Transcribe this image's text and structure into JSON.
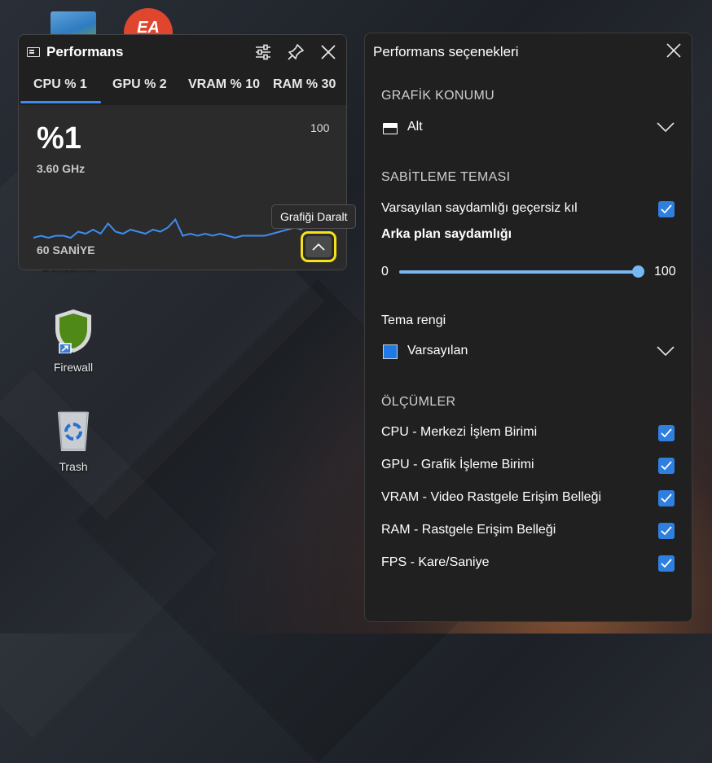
{
  "desktop": {
    "icons": [
      {
        "label": "Denetimler"
      },
      {
        "label": "Firewall"
      },
      {
        "label": "Trash"
      }
    ]
  },
  "performance_widget": {
    "title": "Performans",
    "tabs": [
      {
        "label": "CPU % 1",
        "selected": true
      },
      {
        "label": "GPU % 2",
        "selected": false
      },
      {
        "label": "VRAM % 10",
        "selected": false
      },
      {
        "label": "RAM % 30",
        "selected": false
      }
    ],
    "value": "%1",
    "max": "100",
    "frequency": "3.60 GHz",
    "time_window": "60 SANİYE",
    "tooltip": "Grafiği Daralt",
    "graph_series": [
      2,
      3,
      2,
      3,
      3,
      2,
      5,
      4,
      6,
      4,
      9,
      5,
      4,
      6,
      5,
      4,
      6,
      5,
      7,
      11,
      3,
      4,
      3,
      4,
      3,
      4,
      3,
      2,
      3,
      3,
      3,
      3,
      4,
      5,
      6,
      7,
      6
    ],
    "accent_color": "#3f8cf0",
    "highlight_color": "#f5e21a"
  },
  "options_panel": {
    "title": "Performans seçenekleri",
    "graph_position": {
      "heading": "GRAFİK KONUMU",
      "value": "Alt"
    },
    "pin_theme": {
      "heading": "SABİTLEME TEMASI",
      "override_transparency": {
        "label": "Varsayılan saydamlığı geçersiz kıl",
        "checked": true
      },
      "background_transparency": {
        "label": "Arka plan saydamlığı",
        "min": "0",
        "max": "100",
        "value": 100
      }
    },
    "theme_color": {
      "heading": "Tema rengi",
      "value": "Varsayılan",
      "swatch": "#1f7ae8"
    },
    "metrics": {
      "heading": "ÖLÇÜMLER",
      "items": [
        {
          "label": "CPU - Merkezi İşlem Birimi",
          "checked": true
        },
        {
          "label": "GPU - Grafik İşleme Birimi",
          "checked": true
        },
        {
          "label": "VRAM - Video Rastgele Erişim Belleği",
          "checked": true
        },
        {
          "label": "RAM - Rastgele Erişim Belleği",
          "checked": true
        },
        {
          "label": "FPS - Kare/Saniye",
          "checked": true
        }
      ]
    },
    "check_color": "#2f7fe0"
  }
}
